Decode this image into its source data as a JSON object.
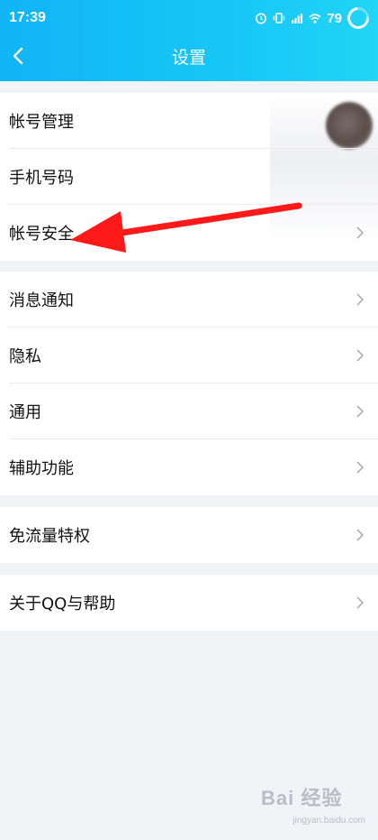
{
  "status_bar": {
    "time": "17:39",
    "battery": "79"
  },
  "nav": {
    "title": "设置"
  },
  "groups": [
    {
      "items": [
        {
          "label": "帐号管理"
        },
        {
          "label": "手机号码"
        },
        {
          "label": "帐号安全"
        }
      ]
    },
    {
      "items": [
        {
          "label": "消息通知"
        },
        {
          "label": "隐私"
        },
        {
          "label": "通用"
        },
        {
          "label": "辅助功能"
        }
      ]
    },
    {
      "items": [
        {
          "label": "免流量特权"
        }
      ]
    },
    {
      "items": [
        {
          "label": "关于QQ与帮助"
        }
      ]
    }
  ],
  "annotation": {
    "arrow_color": "#ff1a1a"
  },
  "watermark": {
    "main": "Bai 经验",
    "sub": "jingyan.baidu.com"
  },
  "colors": {
    "header_gradient": [
      "#11b5f5",
      "#22d4f6"
    ],
    "background": "#f2f3f7"
  }
}
